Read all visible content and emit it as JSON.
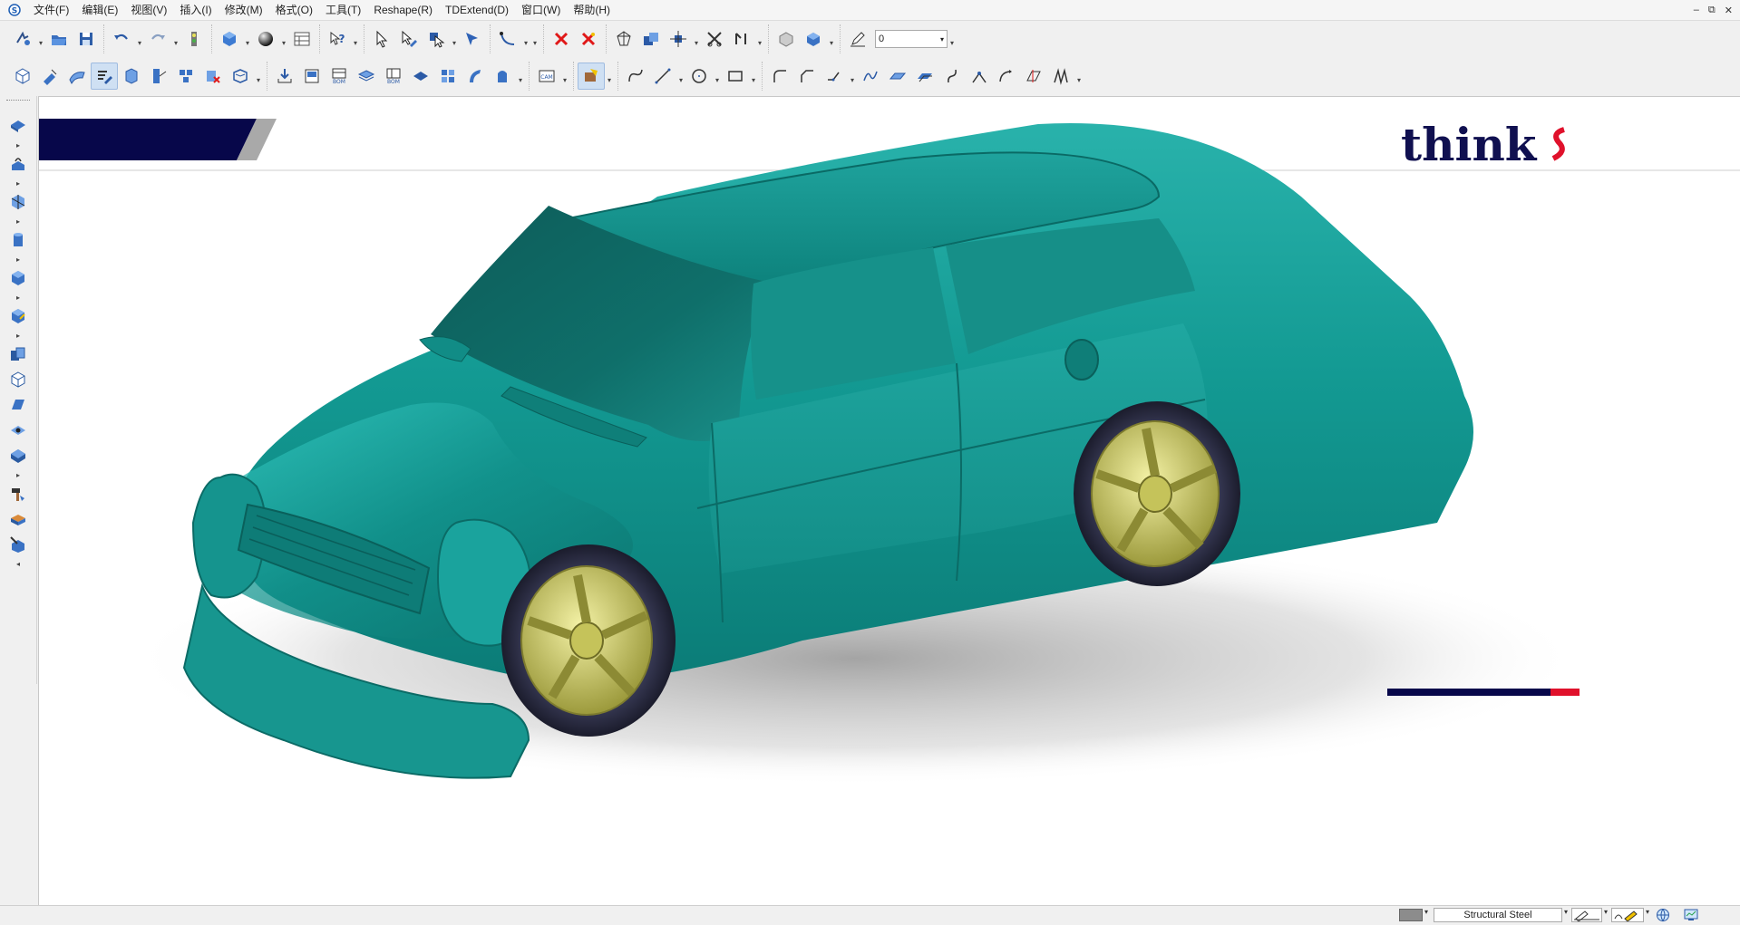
{
  "menubar": {
    "items": [
      "文件(F)",
      "编辑(E)",
      "视图(V)",
      "插入(I)",
      "修改(M)",
      "格式(O)",
      "工具(T)",
      "Reshape(R)",
      "TDExtend(D)",
      "窗口(W)",
      "帮助(H)"
    ],
    "window_controls": [
      "–",
      "⧉",
      "✕"
    ]
  },
  "toolbar": {
    "value_field": "0",
    "dropdown_arrow": "▾"
  },
  "left_panel": {
    "expand_arrow": "▸",
    "collapse_arrow": "◂"
  },
  "viewport": {
    "brand_logo_text": "think",
    "colors": {
      "banner_navy": "#07074a",
      "car_teal": "#1a9e98",
      "wheel_yellow": "#d8d56a",
      "tire_dark": "#2c2e45",
      "accent_red": "#e0112b"
    }
  },
  "statusbar": {
    "material": "Structural Steel"
  }
}
